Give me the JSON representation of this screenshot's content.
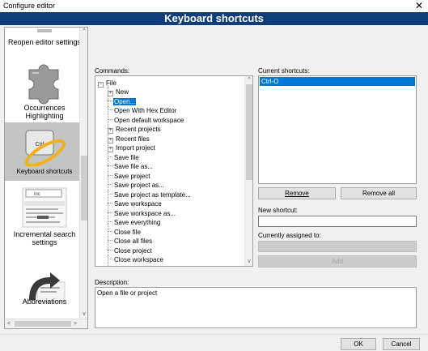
{
  "window": {
    "title": "Configure editor",
    "close_glyph": "✕"
  },
  "header": {
    "title": "Keyboard shortcuts"
  },
  "sidebar": {
    "items": [
      {
        "label": "Reopen editor settings",
        "icon": "reopen-settings-icon"
      },
      {
        "label": "Occurrences Highlighting",
        "icon": "puzzle-piece-icon"
      },
      {
        "label": "Keyboard shortcuts",
        "icon": "keyboard-shortcut-icon",
        "selected": true,
        "icon_text": "Ctrl"
      },
      {
        "label": "Incremental search settings",
        "icon": "incremental-search-icon",
        "icon_text": "inc"
      },
      {
        "label": "Abbreviations",
        "icon": "abbreviation-arrow-icon"
      }
    ],
    "scroll_up": "^",
    "scroll_down": "v",
    "scroll_left": "<",
    "scroll_right": ">"
  },
  "commands": {
    "label": "Commands:",
    "root": "File",
    "items": [
      {
        "label": "New",
        "expandable": true
      },
      {
        "label": "Open...",
        "selected": true
      },
      {
        "label": "Open With Hex Editor"
      },
      {
        "label": "Open default workspace"
      },
      {
        "label": "Recent projects",
        "expandable": true
      },
      {
        "label": "Recent files",
        "expandable": true
      },
      {
        "label": "Import project",
        "expandable": true
      },
      {
        "label": "Save file"
      },
      {
        "label": "Save file as..."
      },
      {
        "label": "Save project"
      },
      {
        "label": "Save project as..."
      },
      {
        "label": "Save project as template..."
      },
      {
        "label": "Save workspace"
      },
      {
        "label": "Save workspace as..."
      },
      {
        "label": "Save everything"
      },
      {
        "label": "Close file"
      },
      {
        "label": "Close all files"
      },
      {
        "label": "Close project"
      },
      {
        "label": "Close workspace"
      }
    ],
    "collapse_glyph": "−",
    "expand_glyph": "+"
  },
  "shortcuts": {
    "current_label": "Current shortcuts:",
    "current": [
      "Ctrl-O"
    ],
    "remove_label": "Remove",
    "remove_all_label": "Remove all",
    "new_label": "New shortcut:",
    "new_value": "",
    "assigned_label": "Currently assigned to:",
    "assigned_value": "",
    "add_label": "Add"
  },
  "description": {
    "label": "Description:",
    "text": "Open a file or project"
  },
  "footer": {
    "ok_label": "OK",
    "cancel_label": "Cancel"
  },
  "colors": {
    "header_bg": "#0f3d7a",
    "selection": "#0078d7",
    "sidebar_selected": "#c3c3c3"
  }
}
